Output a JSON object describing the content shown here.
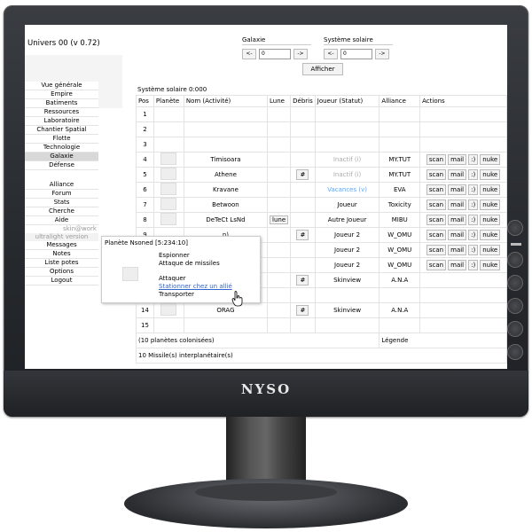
{
  "monitor": {
    "brand": "NYSO"
  },
  "header": {
    "title": "Univers 00 (v 0.72)"
  },
  "nav": {
    "galaxie_label": "Galaxie",
    "systeme_label": "Système solaire",
    "prev": "<-",
    "next": "->",
    "galaxie_value": "0",
    "systeme_value": "0",
    "afficher": "Afficher"
  },
  "menu": {
    "items1": [
      "Vue générale",
      "Empire",
      "Batiments",
      "Ressources",
      "Laboratoire",
      "Chantier Spatial",
      "Flotte",
      "Technologie",
      "Galaxie",
      "Défense"
    ],
    "selected": "Galaxie",
    "items2": [
      "Alliance",
      "Forum",
      "Stats",
      "Cherche",
      "Aide"
    ],
    "skin": "skin@work",
    "ultralight": "ultralight version",
    "items3": [
      "Messages",
      "Notes",
      "Liste potes",
      "Options",
      "Logout"
    ]
  },
  "system_title": "Système solaire 0:000",
  "table": {
    "headers": [
      "Pos",
      "Planète",
      "Nom (Activité)",
      "Lune",
      "Débris",
      "Joueur (Statut)",
      "Alliance",
      "Actions"
    ],
    "rows": [
      {
        "pos": "1",
        "has_img": false,
        "name": "",
        "lune": "",
        "debris": "",
        "joueur": "",
        "statut": "",
        "alliance": "",
        "actions": false
      },
      {
        "pos": "2",
        "has_img": false,
        "name": "",
        "lune": "",
        "debris": "",
        "joueur": "",
        "statut": "",
        "alliance": "",
        "actions": false
      },
      {
        "pos": "3",
        "has_img": false,
        "name": "",
        "lune": "",
        "debris": "",
        "joueur": "",
        "statut": "",
        "alliance": "",
        "actions": false
      },
      {
        "pos": "4",
        "has_img": true,
        "name": "Timisoara",
        "lune": "",
        "debris": "",
        "joueur": "Inactif (i)",
        "statut": "inactive",
        "alliance": "MY.TUT",
        "actions": true
      },
      {
        "pos": "5",
        "has_img": true,
        "name": "Athene",
        "lune": "",
        "debris": "#",
        "joueur": "Inactif (i)",
        "statut": "inactive",
        "alliance": "MY.TUT",
        "actions": true
      },
      {
        "pos": "6",
        "has_img": true,
        "name": "Kravane",
        "lune": "",
        "debris": "",
        "joueur": "Vacances (v)",
        "statut": "vacation",
        "alliance": "EVA",
        "actions": true
      },
      {
        "pos": "7",
        "has_img": true,
        "name": "Betwoon",
        "lune": "",
        "debris": "",
        "joueur": "Joueur",
        "statut": "normal",
        "alliance": "Toxicity",
        "actions": true
      },
      {
        "pos": "8",
        "has_img": true,
        "name": "DeTeCt LsNd",
        "lune": "lune",
        "debris": "",
        "joueur": "Autre Joueur",
        "statut": "normal",
        "alliance": "MIBU",
        "actions": true
      },
      {
        "pos": "9",
        "has_img": false,
        "name": "n)",
        "lune": "",
        "debris": "#",
        "joueur": "Joueur 2",
        "statut": "normal",
        "alliance": "W_OMU",
        "actions": true
      },
      {
        "pos": "10",
        "has_img": false,
        "name": "",
        "lune": "",
        "debris": "",
        "joueur": "Joueur 2",
        "statut": "normal",
        "alliance": "W_OMU",
        "actions": true
      },
      {
        "pos": "11",
        "has_img": false,
        "name": "",
        "lune": "",
        "debris": "",
        "joueur": "Joueur 2",
        "statut": "normal",
        "alliance": "W_OMU",
        "actions": true
      },
      {
        "pos": "12",
        "has_img": false,
        "name": "",
        "lune": "",
        "debris": "#",
        "joueur": "Skinview",
        "statut": "normal",
        "alliance": "A.N.A",
        "actions": false
      },
      {
        "pos": "13",
        "has_img": false,
        "name": "",
        "lune": "",
        "debris": "",
        "joueur": "",
        "statut": "",
        "alliance": "",
        "actions": false
      },
      {
        "pos": "14",
        "has_img": true,
        "name": "ORAG",
        "lune": "",
        "debris": "#",
        "joueur": "Skinview",
        "statut": "normal",
        "alliance": "A.N.A",
        "actions": false
      },
      {
        "pos": "15",
        "has_img": false,
        "name": "",
        "lune": "",
        "debris": "",
        "joueur": "",
        "statut": "",
        "alliance": "",
        "actions": false
      }
    ],
    "action_labels": [
      "scan",
      "mail",
      ":)",
      "nuke"
    ],
    "footer_colonised": "(10 planètes colonisées)",
    "footer_legende": "Légende",
    "footer_missiles": "10 Missile(s) interplanétaire(s)"
  },
  "popup": {
    "title": "Planète Nsoned [5:234:10]",
    "options": [
      "Espionner",
      "Attaque de missiles",
      "Attaquer",
      "Stationner chez un allié",
      "Transporter"
    ],
    "highlighted": "Stationner chez un allié"
  }
}
